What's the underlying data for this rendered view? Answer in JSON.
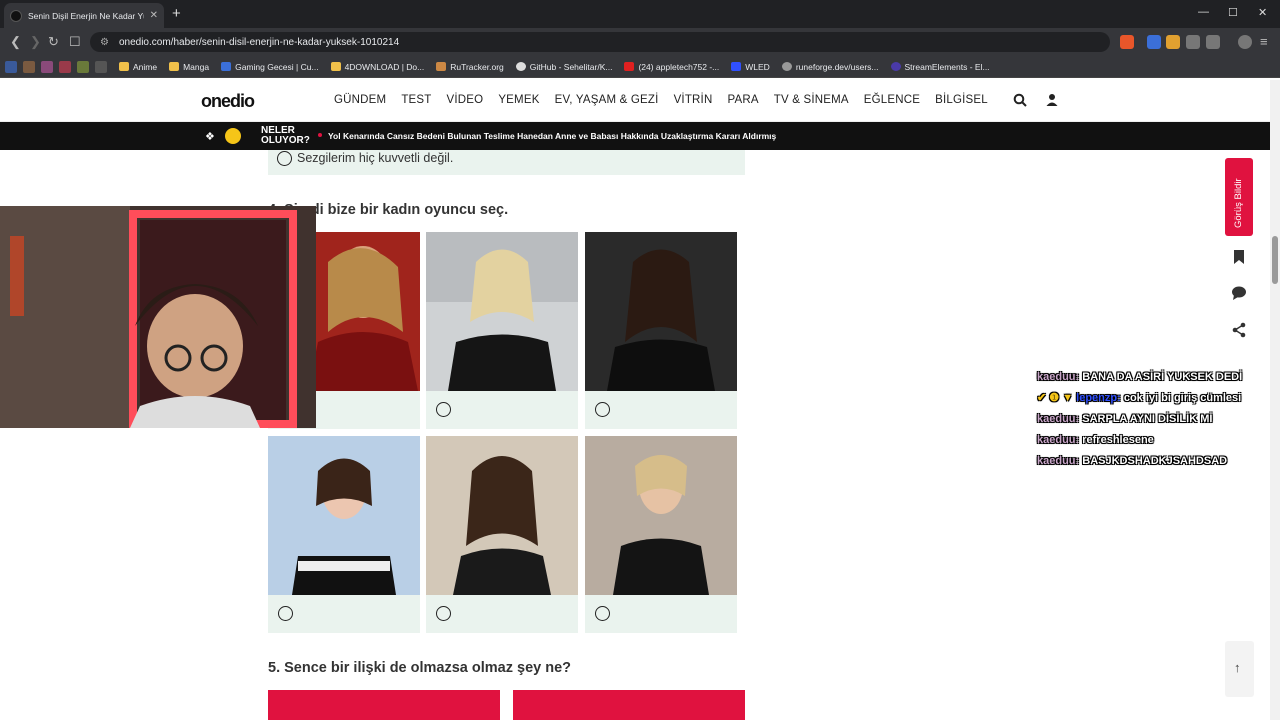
{
  "browser": {
    "tab_title": "Senin Dişil Enerjin Ne Kadar Yük",
    "tab_close": "✕",
    "new_tab": "+",
    "url": "onedio.com/haber/senin-disil-enerjin-ne-kadar-yuksek-1010214",
    "window_controls": [
      "—",
      "☐",
      "✕"
    ],
    "bookmarks": [
      "Anime",
      "Manga",
      "Gaming Gecesi | Cu...",
      "4DOWNLOAD | Do...",
      "RuTracker.org",
      "GitHub - Sehelitar/K...",
      "(24) appletech752 -...",
      "WLED",
      "runeforge.dev/users...",
      "StreamElements - El..."
    ]
  },
  "site": {
    "logo": "onedio",
    "menu": [
      "GÜNDEM",
      "TEST",
      "VİDEO",
      "YEMEK",
      "EV, YAŞAM & GEZİ",
      "VİTRİN",
      "PARA",
      "TV & SİNEMA",
      "EĞLENCE",
      "BİLGİSEL"
    ],
    "ticker_label": "NELER OLUYOR?",
    "ticker_text": "Yol Kenarında Cansız Bedeni Bulunan Teslime Hanedan Anne ve Babası Hakkında Uzaklaştırma Kararı Aldırmış"
  },
  "quiz": {
    "prev_option": "Sezgilerim hiç kuvvetli değil.",
    "q4_title": "4. Şimdi bize bir kadın oyuncu seç.",
    "q5_title": "5. Sence bir ilişki de olmazsa olmaz şey ne?"
  },
  "side": {
    "feedback": "Görüş Bildir",
    "scroll_top": "↑"
  },
  "chat": [
    {
      "user": "kaeduu:",
      "msg": "BANA DA ASİRİ YUKSEK DEDİ",
      "badges": ""
    },
    {
      "user": "lepenzp:",
      "msg": "cok iyi bi giriş cümlesi",
      "badges": "✔ ❶ ▼"
    },
    {
      "user": "kaeduu:",
      "msg": "SARPLA AYNI DİSİLİK Mİ",
      "badges": ""
    },
    {
      "user": "kaeduu:",
      "msg": "refreshlesene",
      "badges": ""
    },
    {
      "user": "kaeduu:",
      "msg": "BASJKDSHADKJSAHDSAD",
      "badges": ""
    }
  ],
  "colors": {
    "accent": "#e0123f",
    "option_bg": "#eaf3ee",
    "ticker_bg": "#111111"
  }
}
